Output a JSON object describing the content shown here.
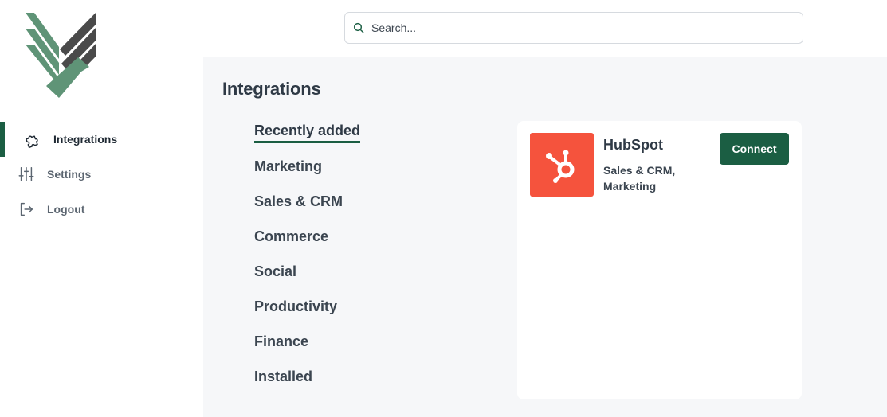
{
  "sidebar": {
    "logo": "brand-logo",
    "items": [
      {
        "label": "Integrations",
        "icon": "puzzle-icon",
        "active": true
      },
      {
        "label": "Settings",
        "icon": "sliders-icon",
        "active": false
      },
      {
        "label": "Logout",
        "icon": "logout-icon",
        "active": false
      }
    ]
  },
  "search": {
    "placeholder": "Search...",
    "value": ""
  },
  "main": {
    "title": "Integrations",
    "categories": [
      {
        "label": "Recently added",
        "active": true
      },
      {
        "label": "Marketing",
        "active": false
      },
      {
        "label": "Sales & CRM",
        "active": false
      },
      {
        "label": "Commerce",
        "active": false
      },
      {
        "label": "Social",
        "active": false
      },
      {
        "label": "Productivity",
        "active": false
      },
      {
        "label": "Finance",
        "active": false
      },
      {
        "label": "Installed",
        "active": false
      }
    ],
    "integrations": [
      {
        "name": "HubSpot",
        "tags_line1": "Sales & CRM,",
        "tags_line2": "Marketing",
        "button_label": "Connect",
        "logo_color": "#f5533d",
        "icon": "hubspot-icon"
      }
    ]
  },
  "colors": {
    "accent": "#1b5e43",
    "logo_green": "#5f9477",
    "logo_gray": "#4a4a4a",
    "background": "#f6f7f9"
  }
}
